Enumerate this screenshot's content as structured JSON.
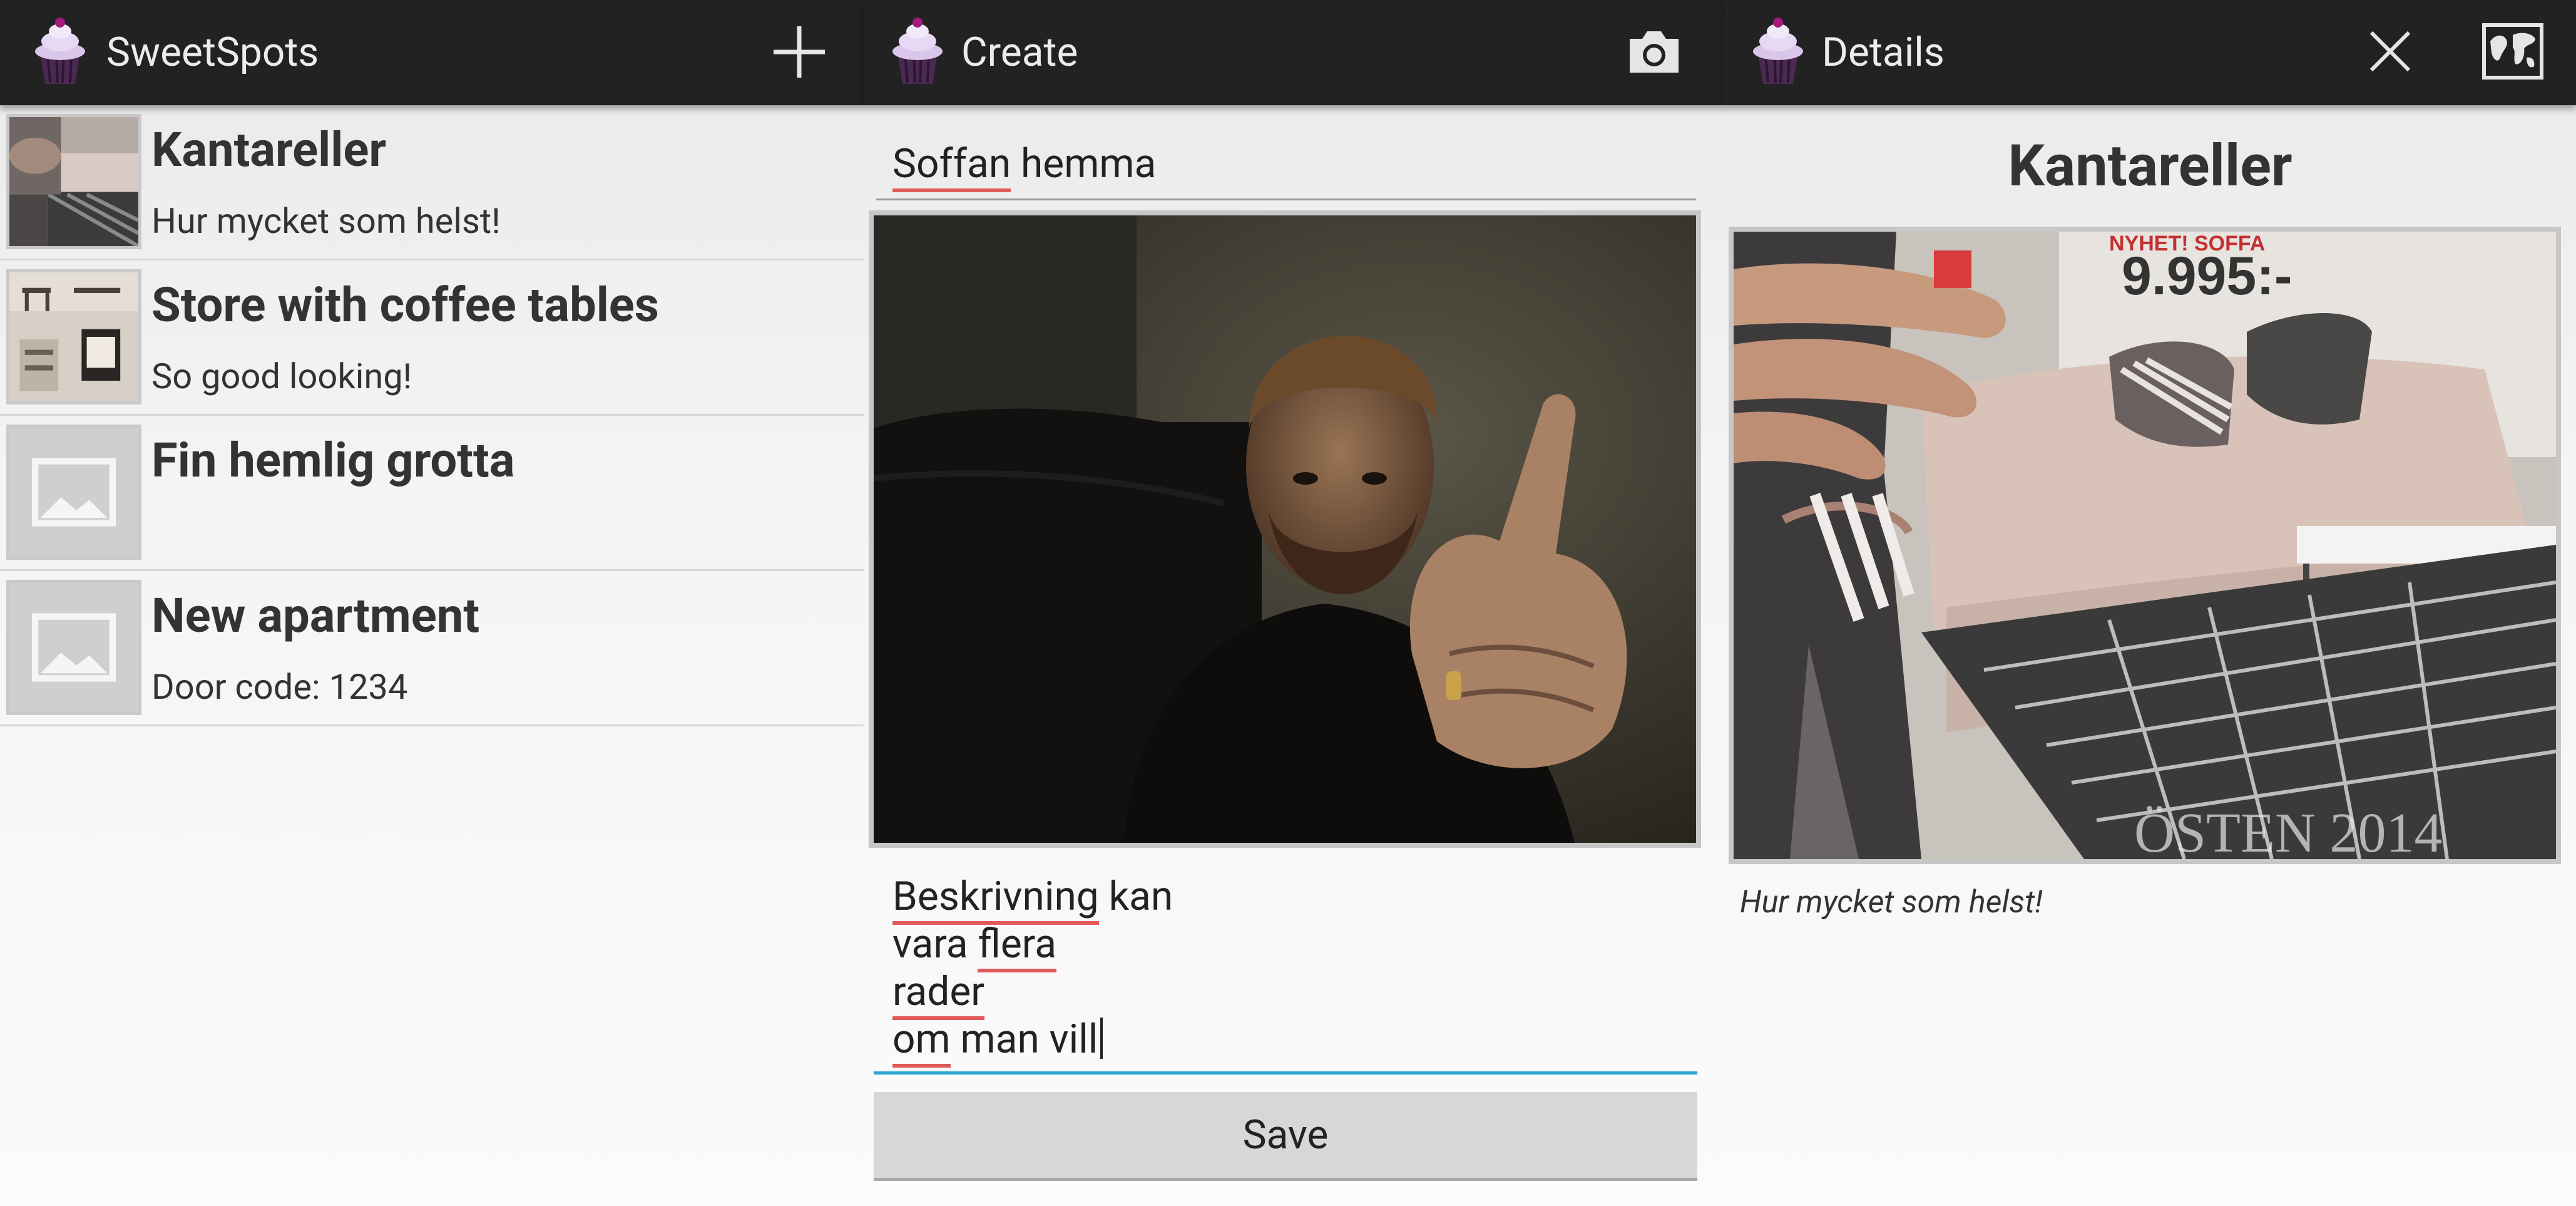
{
  "list_panel": {
    "title": "SweetSpots",
    "items": [
      {
        "title": "Kantareller",
        "description": "Hur mycket som helst!"
      },
      {
        "title": "Store with coffee tables",
        "description": "So good looking!"
      },
      {
        "title": "Fin hemlig grotta",
        "description": ""
      },
      {
        "title": "New apartment",
        "description": "Door code: 1234"
      }
    ]
  },
  "create_panel": {
    "title": "Create",
    "name_value_word1": "Soffan",
    "name_value_word2": " hemma",
    "description_lines": [
      {
        "a": "Beskrivning",
        "b": " kan"
      },
      {
        "a": "vara ",
        "b": "flera"
      },
      {
        "a": "rader",
        "b": ""
      },
      {
        "a": "om",
        "b": " man vill"
      }
    ],
    "save_label": "Save"
  },
  "details_panel": {
    "title": "Details",
    "heading": "Kantareller",
    "description": "Hur mycket som helst!",
    "photo_price_text": "9.995:-",
    "photo_label_text": "NYHET! SOFFA",
    "photo_bottom_text": "ÖSTEN 2014"
  }
}
